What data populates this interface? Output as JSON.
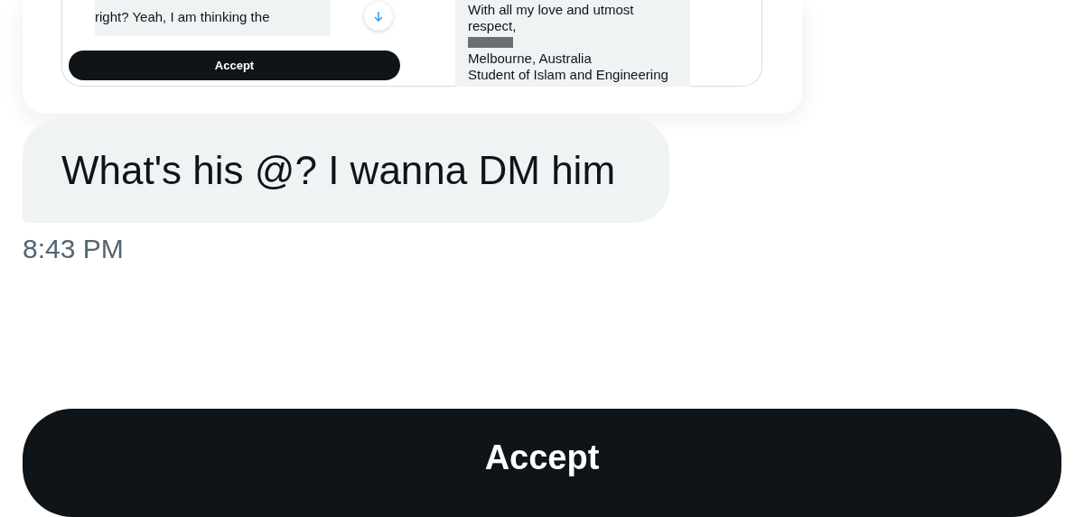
{
  "shared_post": {
    "left_text_lines": [
      "right? Yeah, I am thinking the"
    ],
    "accept_button": "Accept",
    "right_text_lines": [
      {
        "kind": "text",
        "text": "With all my love and utmost"
      },
      {
        "kind": "text",
        "text": "respect,"
      },
      {
        "kind": "redacted"
      },
      {
        "kind": "text",
        "text": "Melbourne, Australia"
      },
      {
        "kind": "text",
        "text": "Student of Islam and Engineering"
      }
    ]
  },
  "message": {
    "text": "What's his @? I wanna DM him",
    "time": "8:43 PM"
  },
  "accept_button": "Accept"
}
